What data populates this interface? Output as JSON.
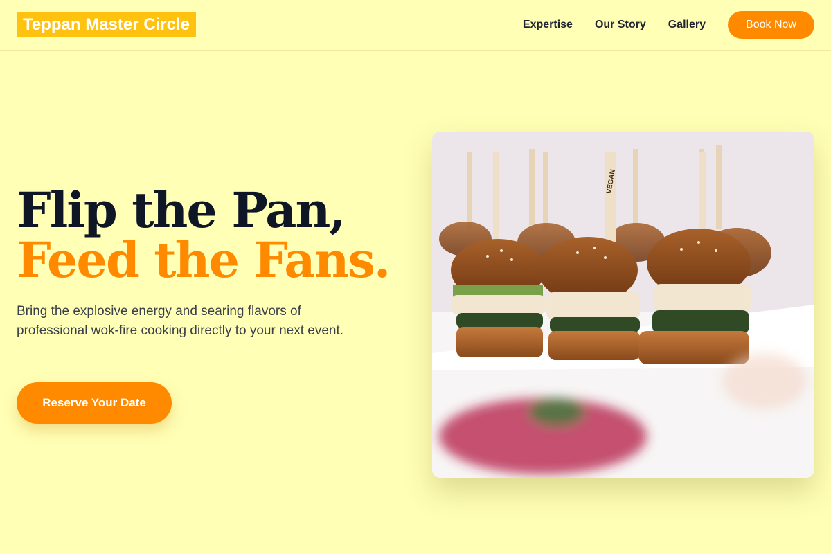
{
  "header": {
    "logo": "Teppan Master Circle",
    "nav": [
      "Expertise",
      "Our Story",
      "Gallery"
    ],
    "book_label": "Book Now"
  },
  "hero": {
    "title_line1": "Flip the Pan,",
    "title_line2": "Feed the Fans.",
    "subtitle": "Bring the explosive energy and searing flavors of professional wok-fire cooking directly to your next event.",
    "cta_label": "Reserve Your Date"
  },
  "image": {
    "alt": "sliders-with-vegan-picks",
    "pick_label": "VEGAN"
  },
  "colors": {
    "background": "#FFFFB5",
    "accent": "#FF8A00",
    "logo_bg": "#FFC20E",
    "title_dark": "#0f1726"
  }
}
